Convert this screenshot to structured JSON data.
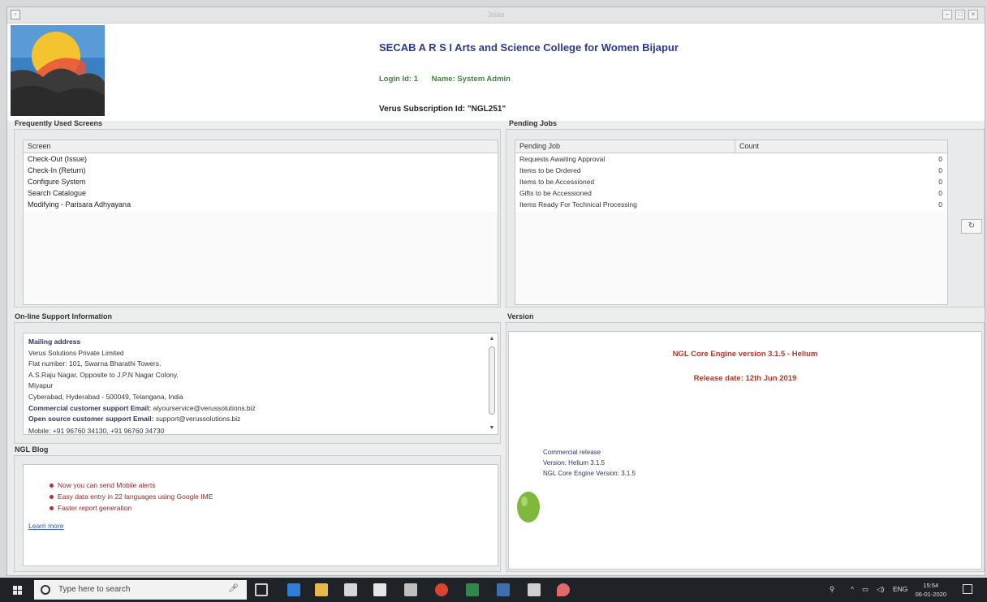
{
  "window": {
    "title": "Jolas"
  },
  "header": {
    "college_name": "SECAB A R S I Arts and Science College for Women Bijapur",
    "login_id": "Login Id: 1",
    "user_name": "Name: System Admin",
    "subscription": "Verus Subscription Id: \"NGL251\""
  },
  "frequently_used": {
    "title": "Frequently Used Screens",
    "column": "Screen",
    "items": [
      "Check-Out (Issue)",
      "Check-In (Return)",
      "Configure System",
      "Search Catalogue",
      "Modifying - Parisara Adhyayana"
    ]
  },
  "pending_jobs": {
    "title": "Pending Jobs",
    "col_job": "Pending Job",
    "col_count": "Count",
    "rows": [
      {
        "job": "Requests Awaiting Approval",
        "count": "0"
      },
      {
        "job": "Items to be Ordered",
        "count": "0"
      },
      {
        "job": "Items to be Accessioned",
        "count": "0"
      },
      {
        "job": "Gifts to be Accessioned",
        "count": "0"
      },
      {
        "job": "Items Ready For Technical Processing",
        "count": "0"
      }
    ],
    "refresh_icon": "refresh-icon"
  },
  "support": {
    "title": "On-line Support Information",
    "lines": [
      {
        "text": "Mailing address",
        "bold": true
      },
      {
        "text": "Verus Solutions Private Limited",
        "bold": false
      },
      {
        "text": "Flat number: 101, Swarna Bharathi Towers.",
        "bold": false
      },
      {
        "text": "A.S.Raju Nagar, Opposite to J.P.N Nagar Colony,",
        "bold": false
      },
      {
        "text": "Miyapur",
        "bold": false
      },
      {
        "text": "Cyberabad, Hyderabad - 500049, Telangana, India",
        "bold": false
      }
    ],
    "commercial_label": "Commercial customer support Email:",
    "commercial_email": "alyourservice@verussolutions.biz",
    "opensource_label": "Open source customer support Email:",
    "opensource_email": "support@verussolutions.biz",
    "mobile_partial": "Mobile: +91 96760 34130, +91 96760 34730"
  },
  "blog": {
    "title": "NGL Blog",
    "items": [
      "Now you can send Mobile alerts",
      "Easy data entry in 22 languages using Google IME",
      "Faster report generation"
    ],
    "learn_more": "Learn more"
  },
  "version": {
    "title": "Version",
    "engine": "NGL Core Engine version 3.1.5 - Helium",
    "release_date": "Release date: 12th Jun 2019",
    "release_type": "Commercial release",
    "version_line": "Version: Helium   3.1.5",
    "core_line": "NGL Core Engine Version: 3.1.5"
  },
  "taskbar": {
    "search_placeholder": "Type here to search",
    "lang": "ENG",
    "time": "15:54",
    "date": "06-01-2020"
  },
  "colors": {
    "title_blue": "#2b3a8a",
    "login_green": "#3a8a3a",
    "version_red": "#b03a2a",
    "taskbar": "#1f2327"
  }
}
